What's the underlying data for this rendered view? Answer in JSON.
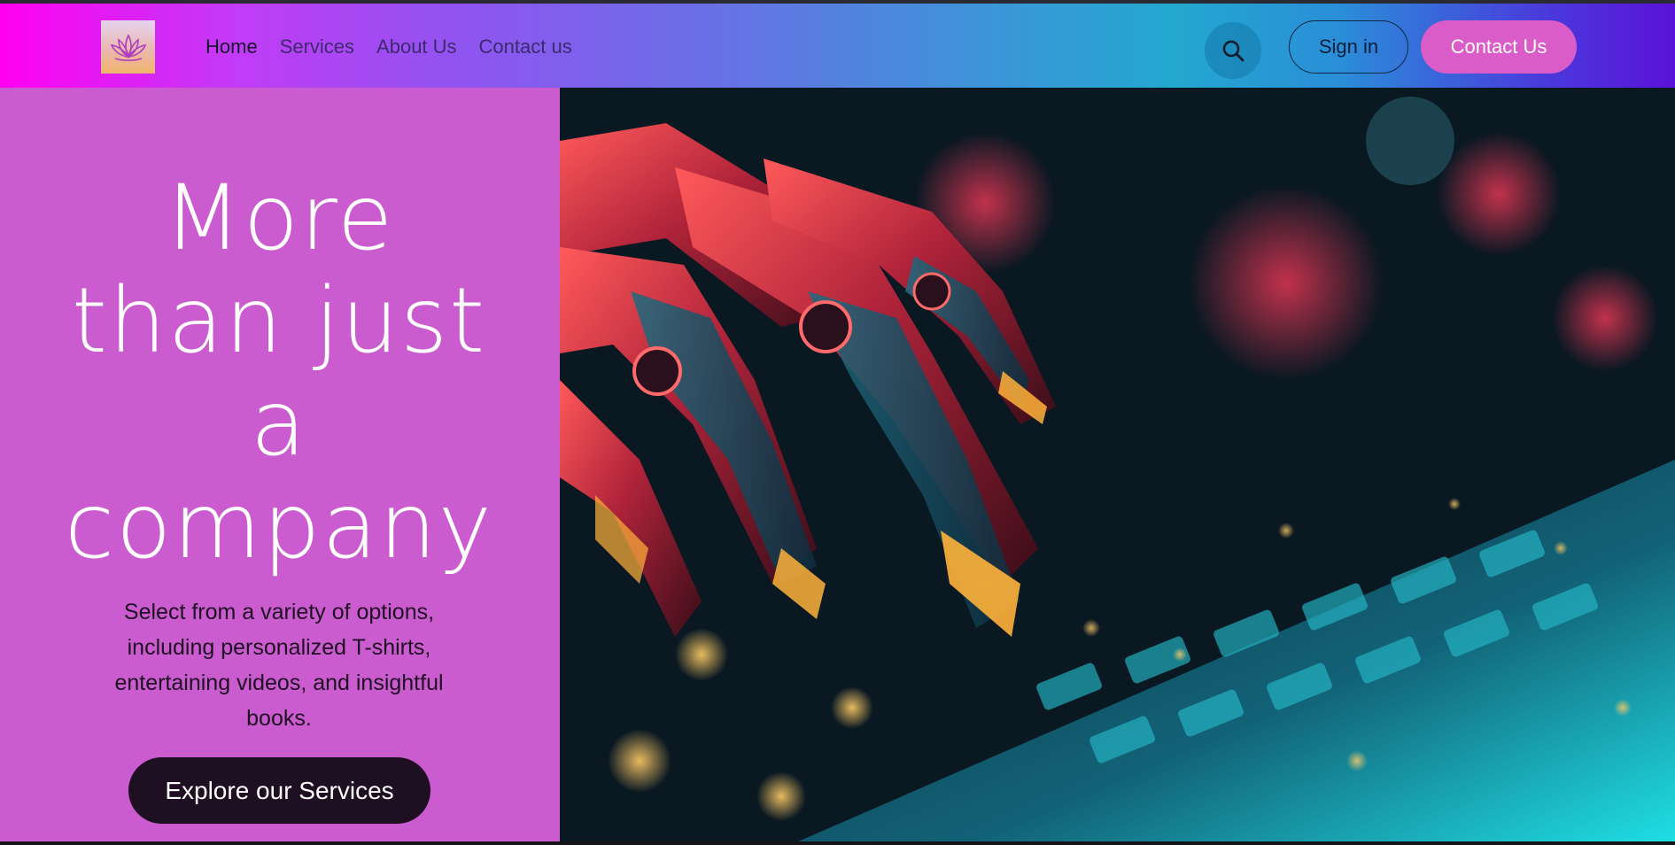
{
  "nav": {
    "logo_icon": "lotus-icon",
    "links": [
      {
        "label": "Home",
        "active": true
      },
      {
        "label": "Services",
        "active": false
      },
      {
        "label": "About Us",
        "active": false
      },
      {
        "label": "Contact us",
        "active": false
      }
    ],
    "search_icon": "search-icon",
    "signin_label": "Sign in",
    "contact_label": "Contact Us"
  },
  "hero": {
    "headline_lines": [
      "More",
      "than just",
      "a",
      "company"
    ],
    "subtext": "Select from a variety of options, including personalized T-shirts, entertaining videos, and insightful books.",
    "cta_label": "Explore our Services",
    "image_subject": "robotic-hand-typing-on-keyboard"
  },
  "colors": {
    "panel": "#cb5ccf",
    "cta_bg": "#1e0f22",
    "contact_btn": "#d95cc8"
  }
}
